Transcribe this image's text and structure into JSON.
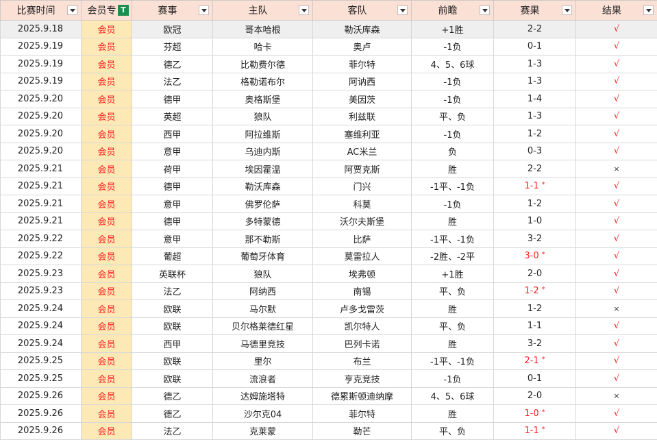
{
  "headers": [
    "比赛时间",
    "会员专",
    "赛事",
    "主队",
    "客队",
    "前瞻",
    "赛果",
    "结果"
  ],
  "rows": [
    {
      "date": "2025.9.18",
      "member": "会员",
      "league": "欧冠",
      "home": "哥本哈根",
      "away": "勒沃库森",
      "pred": "+1胜",
      "score": "2-2",
      "result": "√"
    },
    {
      "date": "2025.9.19",
      "member": "会员",
      "league": "芬超",
      "home": "哈卡",
      "away": "奥卢",
      "pred": "-1负",
      "score": "0-1",
      "result": "√"
    },
    {
      "date": "2025.9.19",
      "member": "会员",
      "league": "德乙",
      "home": "比勒费尔德",
      "away": "菲尔特",
      "pred": "4、5、6球",
      "score": "1-3",
      "result": "√"
    },
    {
      "date": "2025.9.19",
      "member": "会员",
      "league": "法乙",
      "home": "格勒诺布尔",
      "away": "阿讷西",
      "pred": "-1负",
      "score": "1-3",
      "result": "√"
    },
    {
      "date": "2025.9.20",
      "member": "会员",
      "league": "德甲",
      "home": "奥格斯堡",
      "away": "美因茨",
      "pred": "-1负",
      "score": "1-4",
      "result": "√"
    },
    {
      "date": "2025.9.20",
      "member": "会员",
      "league": "英超",
      "home": "狼队",
      "away": "利兹联",
      "pred": "平、负",
      "score": "1-3",
      "result": "√"
    },
    {
      "date": "2025.9.20",
      "member": "会员",
      "league": "西甲",
      "home": "阿拉维斯",
      "away": "塞维利亚",
      "pred": "-1负",
      "score": "1-2",
      "result": "√"
    },
    {
      "date": "2025.9.20",
      "member": "会员",
      "league": "意甲",
      "home": "乌迪内斯",
      "away": "AC米兰",
      "pred": "负",
      "score": "0-3",
      "result": "√"
    },
    {
      "date": "2025.9.21",
      "member": "会员",
      "league": "荷甲",
      "home": "埃因霍温",
      "away": "阿贾克斯",
      "pred": "胜",
      "score": "2-2",
      "result": "×"
    },
    {
      "date": "2025.9.21",
      "member": "会员",
      "league": "德甲",
      "home": "勒沃库森",
      "away": "门兴",
      "pred": "-1平、-1负",
      "score": "1-1",
      "star": "*",
      "result": "√"
    },
    {
      "date": "2025.9.21",
      "member": "会员",
      "league": "意甲",
      "home": "佛罗伦萨",
      "away": "科莫",
      "pred": "-1负",
      "score": "1-2",
      "result": "√"
    },
    {
      "date": "2025.9.21",
      "member": "会员",
      "league": "德甲",
      "home": "多特蒙德",
      "away": "沃尔夫斯堡",
      "pred": "胜",
      "score": "1-0",
      "result": "√"
    },
    {
      "date": "2025.9.22",
      "member": "会员",
      "league": "意甲",
      "home": "那不勒斯",
      "away": "比萨",
      "pred": "-1平、-1负",
      "score": "3-2",
      "result": "√"
    },
    {
      "date": "2025.9.22",
      "member": "会员",
      "league": "葡超",
      "home": "葡萄牙体育",
      "away": "莫雷拉人",
      "pred": "-2胜、-2平",
      "score": "3-0",
      "star": "*",
      "result": "√"
    },
    {
      "date": "2025.9.23",
      "member": "会员",
      "league": "英联杯",
      "home": "狼队",
      "away": "埃弗顿",
      "pred": "+1胜",
      "score": "2-0",
      "result": "√"
    },
    {
      "date": "2025.9.23",
      "member": "会员",
      "league": "法乙",
      "home": "阿纳西",
      "away": "南锡",
      "pred": "平、负",
      "score": "1-2",
      "star": "*",
      "result": "√"
    },
    {
      "date": "2025.9.24",
      "member": "会员",
      "league": "欧联",
      "home": "马尔默",
      "away": "卢多戈雷茨",
      "pred": "胜",
      "score": "1-2",
      "result": "×"
    },
    {
      "date": "2025.9.24",
      "member": "会员",
      "league": "欧联",
      "home": "贝尔格莱德红星",
      "away": "凯尔特人",
      "pred": "平、负",
      "score": "1-1",
      "result": "√"
    },
    {
      "date": "2025.9.24",
      "member": "会员",
      "league": "西甲",
      "home": "马德里竞技",
      "away": "巴列卡诺",
      "pred": "胜",
      "score": "3-2",
      "result": "√"
    },
    {
      "date": "2025.9.25",
      "member": "会员",
      "league": "欧联",
      "home": "里尔",
      "away": "布兰",
      "pred": "-1平、-1负",
      "score": "2-1",
      "star": "*",
      "result": "√"
    },
    {
      "date": "2025.9.25",
      "member": "会员",
      "league": "欧联",
      "home": "流浪者",
      "away": "亨克竞技",
      "pred": "-1负",
      "score": "0-1",
      "result": "√"
    },
    {
      "date": "2025.9.26",
      "member": "会员",
      "league": "德乙",
      "home": "达姆施塔特",
      "away": "德累斯顿迪纳摩",
      "pred": "4、5、6球",
      "score": "2-0",
      "result": "×"
    },
    {
      "date": "2025.9.26",
      "member": "会员",
      "league": "德乙",
      "home": "沙尔克04",
      "away": "菲尔特",
      "pred": "胜",
      "score": "1-0",
      "star": "*",
      "result": "√"
    },
    {
      "date": "2025.9.26",
      "member": "会员",
      "league": "法乙",
      "home": "克莱蒙",
      "away": "勒芒",
      "pred": "平、负",
      "score": "1-1",
      "star": "*",
      "result": "√"
    }
  ],
  "colors": {
    "header_bg": "#fbe0d6",
    "member_bg": "#fde9b6",
    "accent_red": "#ff2020",
    "filter_green": "#1e8e4f"
  },
  "icons": {
    "dropdown": "dropdown-arrow-icon",
    "filter": "filter-active-icon"
  }
}
